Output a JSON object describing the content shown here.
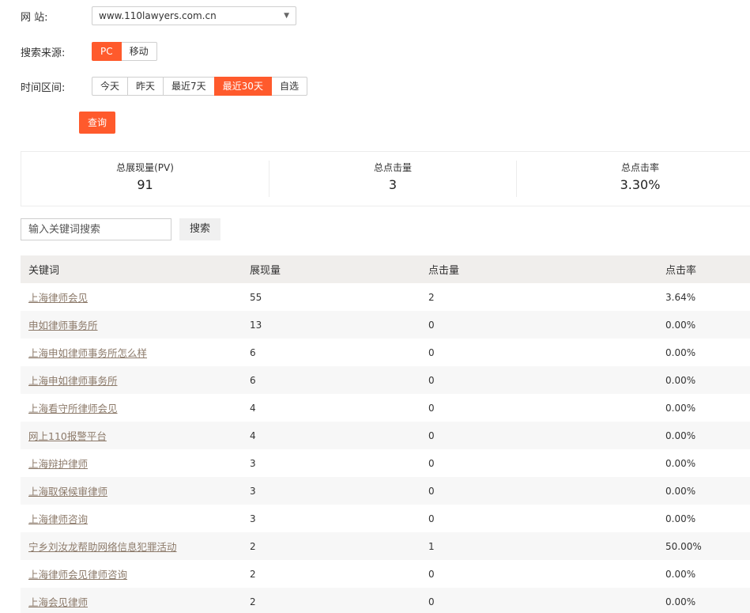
{
  "filters": {
    "site_label": "网 站:",
    "site_value": "www.110lawyers.com.cn",
    "source_label": "搜索来源:",
    "source_options": [
      "PC",
      "移动"
    ],
    "source_selected": "PC",
    "time_label": "时间区间:",
    "time_options": [
      "今天",
      "昨天",
      "最近7天",
      "最近30天",
      "自选"
    ],
    "time_selected": "最近30天",
    "query_button": "查询"
  },
  "stats": {
    "pv_label": "总展现量(PV)",
    "pv_value": "91",
    "clicks_label": "总点击量",
    "clicks_value": "3",
    "ctr_label": "总点击率",
    "ctr_value": "3.30%"
  },
  "search": {
    "placeholder": "输入关键词搜索",
    "button": "搜索"
  },
  "table": {
    "headers": [
      "关键词",
      "展现量",
      "点击量",
      "点击率"
    ],
    "rows": [
      {
        "keyword": "上海律师会见",
        "impressions": "55",
        "clicks": "2",
        "ctr": "3.64%"
      },
      {
        "keyword": "申如律师事务所",
        "impressions": "13",
        "clicks": "0",
        "ctr": "0.00%"
      },
      {
        "keyword": "上海申如律师事务所怎么样",
        "impressions": "6",
        "clicks": "0",
        "ctr": "0.00%"
      },
      {
        "keyword": "上海申如律师事务所",
        "impressions": "6",
        "clicks": "0",
        "ctr": "0.00%"
      },
      {
        "keyword": "上海看守所律师会见",
        "impressions": "4",
        "clicks": "0",
        "ctr": "0.00%"
      },
      {
        "keyword": "网上110报警平台",
        "impressions": "4",
        "clicks": "0",
        "ctr": "0.00%"
      },
      {
        "keyword": "上海辩护律师",
        "impressions": "3",
        "clicks": "0",
        "ctr": "0.00%"
      },
      {
        "keyword": "上海取保候审律师",
        "impressions": "3",
        "clicks": "0",
        "ctr": "0.00%"
      },
      {
        "keyword": "上海律师咨询",
        "impressions": "3",
        "clicks": "0",
        "ctr": "0.00%"
      },
      {
        "keyword": "宁乡刘汝龙帮助网络信息犯罪活动",
        "impressions": "2",
        "clicks": "1",
        "ctr": "50.00%"
      },
      {
        "keyword": "上海律师会见律师咨询",
        "impressions": "2",
        "clicks": "0",
        "ctr": "0.00%"
      },
      {
        "keyword": "上海会见律师",
        "impressions": "2",
        "clicks": "0",
        "ctr": "0.00%"
      }
    ]
  },
  "colors": {
    "accent": "#ff5a2c",
    "link": "#8c7a6a"
  }
}
